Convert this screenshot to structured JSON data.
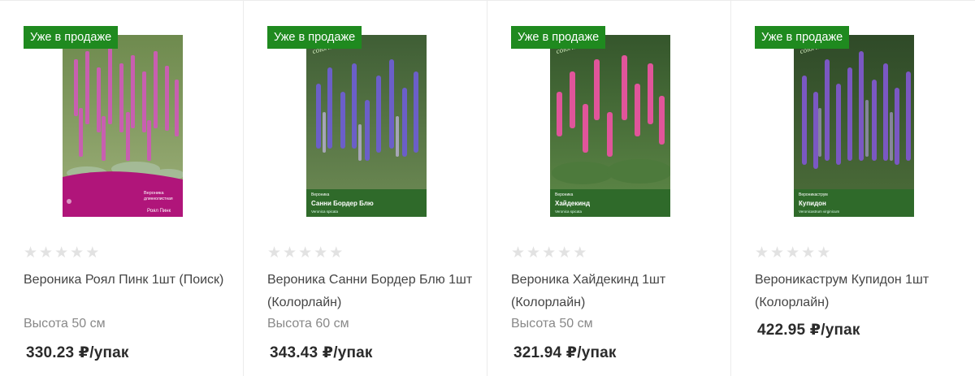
{
  "products": [
    {
      "badge": "Уже в продаже",
      "rating_stars": [
        "★",
        "★",
        "★",
        "★",
        "★"
      ],
      "rating_value": 0,
      "title": "Вероника Роял Пинк 1шт (Поиск)",
      "height": "Высота 50 см",
      "price": "330.23 ₽/упак",
      "image_icon": "veronica-royal-pink-seed-packet",
      "pack_label": "Вероника длиннолистная",
      "pack_name": "Роял Пинк",
      "colors": {
        "flower": "#c85fb0",
        "band": "#b0157a"
      }
    },
    {
      "badge": "Уже в продаже",
      "rating_stars": [
        "★",
        "★",
        "★",
        "★",
        "★"
      ],
      "rating_value": 0,
      "title": "Вероника Санни Бордер Блю 1шт (Колорлайн)",
      "height": "Высота 60 см",
      "price": "343.43 ₽/упак",
      "image_icon": "veronica-sunny-border-blue-seed-packet",
      "pack_label": "Вероника",
      "pack_name": "Санни Бордер Блю",
      "colors": {
        "flower": "#6b5fc8",
        "band": "#2f6a2a"
      }
    },
    {
      "badge": "Уже в продаже",
      "rating_stars": [
        "★",
        "★",
        "★",
        "★",
        "★"
      ],
      "rating_value": 0,
      "title": "Вероника Хайдекинд 1шт (Колорлайн)",
      "height": "Высота 50 см",
      "price": "321.94 ₽/упак",
      "image_icon": "veronica-heidekind-seed-packet",
      "pack_label": "Вероника",
      "pack_name": "Хайдекинд",
      "colors": {
        "flower": "#e0559a",
        "band": "#2f6a2a"
      }
    },
    {
      "badge": "Уже в продаже",
      "rating_stars": [
        "★",
        "★",
        "★",
        "★",
        "★"
      ],
      "rating_value": 0,
      "title": "Вероникаструм Купидон 1шт (Колорлайн)",
      "height": "",
      "price": "422.95 ₽/упак",
      "image_icon": "veronicastrum-cupid-seed-packet",
      "pack_label": "Вероникаструм",
      "pack_name": "Купидон",
      "colors": {
        "flower": "#7a58c2",
        "band": "#2f6a2a"
      }
    }
  ],
  "theme": {
    "badge_bg": "#1f8a1f",
    "star_empty": "#e2e2e2"
  }
}
